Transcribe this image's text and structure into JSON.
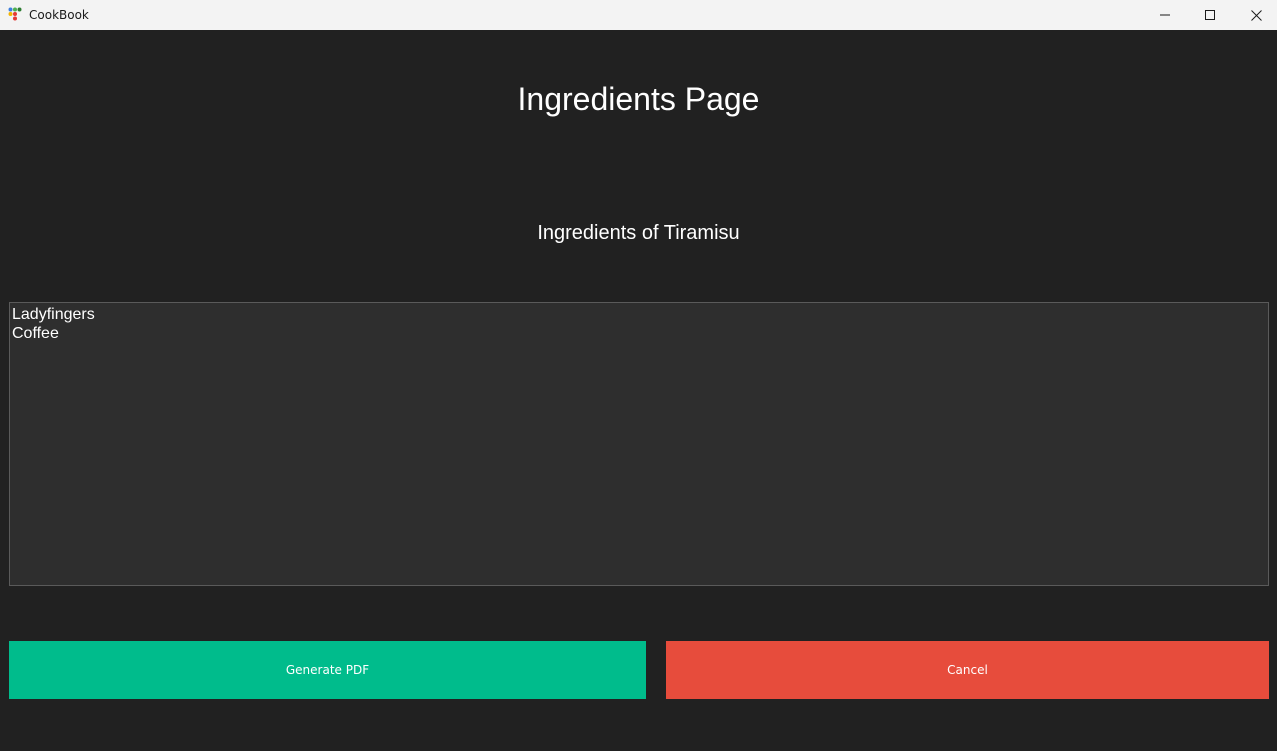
{
  "window": {
    "title": "CookBook",
    "app_icon": "cookbook-dots-icon",
    "controls": {
      "minimize_icon": "minimize-icon",
      "maximize_icon": "maximize-icon",
      "close_icon": "close-icon"
    }
  },
  "main": {
    "page_title": "Ingredients Page",
    "recipe_heading": "Ingredients of Tiramisu",
    "ingredients": [
      "Ladyfingers",
      "Coffee"
    ]
  },
  "actions": {
    "generate_label": "Generate PDF",
    "cancel_label": "Cancel"
  },
  "colors": {
    "background": "#212121",
    "textbox_background": "#2e2e2e",
    "generate_button": "#00bc8c",
    "cancel_button": "#e74c3c",
    "titlebar": "#f3f3f3"
  }
}
